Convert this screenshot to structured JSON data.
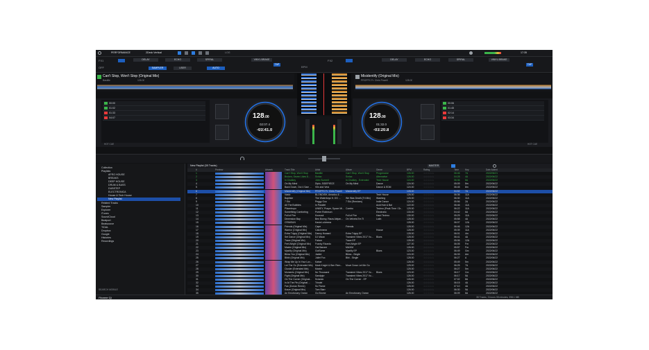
{
  "header": {
    "mode": "PERFORMANCE",
    "layout": "2Deck Vertical",
    "center_label": "LOG",
    "time": "17:35",
    "brand": "Pioneer Dj"
  },
  "fx": {
    "fx1_label": "FX1",
    "fx2_label": "FX2",
    "fx1_slots": [
      "DELAY",
      "ECHO",
      "SPIRAL"
    ],
    "fx2_slots": [
      "DELAY",
      "ECHO",
      "SPIRAL"
    ],
    "fx1_extra": "VINYL BRAKE",
    "fx2_extra": "VINYL BRAKE",
    "off_label": "OFF",
    "sampler_label": "SAMPLER",
    "user_label": "USER",
    "tap_label": "TAP",
    "auto_label": "AUTO",
    "bpm_label": "BPM"
  },
  "deck1": {
    "title": "Can't Stop, Won't Stop (Original Mix)",
    "artist": "Bastille",
    "bpm_small": "126.00",
    "bpm_int": "128",
    "bpm_dec": ".00",
    "elapsed": "02:07.4",
    "remain": "-03:41.0",
    "hotcue_label": "HOT CUE",
    "hotcues": [
      {
        "time": "00:00",
        "color": "#3bb54a"
      },
      {
        "time": "01:02",
        "color": "#3bb54a"
      },
      {
        "time": "01:33",
        "color": "#e83a3a"
      },
      {
        "time": "04:07",
        "color": "#e83a3a"
      }
    ]
  },
  "deck2": {
    "title": "Misidentify (Original Mix)",
    "artist": "PROPFX Fr. Chris Powell",
    "bpm_small": "128.00",
    "bpm_int": "128",
    "bpm_dec": ".00",
    "elapsed": "01:32.0",
    "remain": "-03:20.8",
    "hotcue_label": "HOT CUE",
    "hotcues": [
      {
        "time": "00:06",
        "color": "#3bb54a"
      },
      {
        "time": "01:45",
        "color": "#3bb54a"
      },
      {
        "time": "02:14",
        "color": "#e83a3a"
      },
      {
        "time": "03:34",
        "color": "#e83a3a"
      }
    ]
  },
  "browser": {
    "sidebar": [
      "Collection",
      "Playlists",
      "AFRO HOUSE",
      "BREAKS",
      "DEEP HOUSE",
      "DRUM & BASS",
      "DUBSTEP",
      "ELECTRONICA",
      "House & Tech House",
      "New Playlist",
      "Related Tracks",
      "Sampler",
      "Explorer",
      "iTunes",
      "SoundCloud",
      "Beatport",
      "Beatsource",
      "TIDAL",
      "Dropbox",
      "Google",
      "Histories",
      "Recordings"
    ],
    "search_mobile_label": "SEARCH MOBILE",
    "playlist_header": "New Playlist (35 Tracks)",
    "master_label": "MASTER",
    "status_text": "35 Tracks, 3 hours 05 minutes, 398.1 MB",
    "columns": [
      "#",
      "Preview",
      "Artwork",
      "Track Title",
      "Artist",
      "Album",
      "Genre",
      "BPM",
      "Rating",
      "Time",
      "Key",
      "Date Added"
    ],
    "tracks": [
      [
        "1",
        "Can't Stop, Won't Stop",
        "Bastille",
        "Can't Stop, Won't Stop",
        "Progressive",
        "126.00",
        "06:46",
        "7A",
        "2022/06/21"
      ],
      [
        "2",
        "Broken, Seven Likes 8...",
        "Svrlax",
        "Svrlax",
        "Alternative",
        "126.00",
        "04:28",
        "4A",
        "2022/06/22"
      ],
      [
        "3",
        "In Chalkey",
        "John Summit",
        "In Chalkey - Extended",
        "Tech House",
        "124.00",
        "06:36",
        "8A",
        "2022/06/22"
      ],
      [
        "4",
        "On My Mind",
        "Diplo, SIDEPIECE",
        "On My Mind",
        "Dance",
        "124.00",
        "05:09",
        "8m",
        "2022/06/22"
      ],
      [
        "5",
        "Back Down, Out 4 Sam ...",
        "Vlin and Vera",
        "",
        "Dance & EDM",
        "124.00",
        "06:45",
        "8m",
        "2022/06/22"
      ],
      [
        "6",
        "Misidentify (Original Mix)",
        "PROPFX Fr. Chris Powell",
        "Misidentify EP",
        "",
        "128.00",
        "04:52",
        "7A",
        "2022/06/22"
      ],
      [
        "7",
        "Vasto",
        "BLONDISH, Amadou & ...",
        "",
        "Tech House",
        "126.00",
        "06:36",
        "11A",
        "2022/06/22"
      ],
      [
        "8",
        "Baptiste",
        "The Waterboys ft. OG ...",
        "We Was Death (Tri Mix)",
        "Washing",
        "126.00",
        "06:30",
        "11A",
        "2022/06/22"
      ],
      [
        "9",
        "7 Ekt",
        "Peggy Gou",
        "7 Ekt (Remixes)",
        "Indie Dance",
        "124.00",
        "05:56",
        "2A",
        "2022/06/22"
      ],
      [
        "10",
        "All The Bubbles",
        "In Parallel",
        "",
        "Acid Hub & Bal",
        "122.00",
        "06:46",
        "11A",
        "2022/06/22"
      ],
      [
        "11",
        "Pilsentropo",
        "UNKEY, Prayer, Space Mi...",
        "Combo",
        "Techno (Peak Time / Dr...",
        "125.00",
        "06:22",
        "11A",
        "2022/06/22"
      ],
      [
        "12",
        "Something Comforting",
        "Porter Robinson",
        "",
        "Electronic",
        "133.00",
        "04:42",
        "6A",
        "2022/06/22"
      ],
      [
        "13",
        "Full of Fire",
        "Koosoul",
        "Full of Fire",
        "Hard Techno",
        "130.00",
        "05:29",
        "11A",
        "2022/06/22"
      ],
      [
        "14",
        "Dimension Bay",
        "Ben Bonny, Rauw Alejan...",
        "On Velvets Em Ti",
        "Latin",
        "128.00",
        "05:58",
        "4A",
        "2022/06/22"
      ],
      [
        "15",
        "CRIMSUN",
        "Kasia Lukimma",
        "",
        "",
        "128.00",
        "06:07",
        "12A",
        "2022/06/22"
      ],
      [
        "16",
        "Friends (Original Mix)",
        "Cape",
        "Friends",
        "",
        "128.00",
        "06:46",
        "12A",
        "2022/06/22"
      ],
      [
        "17",
        "Warrior (Original Mix)",
        "Catchmeez",
        "",
        "House",
        "128.00",
        "05:39",
        "11A",
        "2022/06/22"
      ],
      [
        "18",
        "Extra Trippy (Original Mix)",
        "Danny Howard",
        "Extra Trippy EP",
        "",
        "128.00",
        "06:01",
        "4m",
        "2022/06/22"
      ],
      [
        "19",
        "Set Dance (Original Mix)",
        "DJ Mizan",
        "Transient Vibes 2017 Vo...",
        "Blues",
        "128.00",
        "06:41",
        "4A",
        "2022/06/22"
      ],
      [
        "20",
        "Trace (Original Mix)",
        "Falcon",
        "Trace EP",
        "",
        "128.00",
        "05:06",
        "12A",
        "2022/06/22"
      ],
      [
        "21",
        "Feel Alright (Original Mix)",
        "Franky Rizardo",
        "Feel Alright EP",
        "",
        "127.00",
        "06:05",
        "Fm",
        "2022/06/22"
      ],
      [
        "22",
        "Maxim (Original Mix)",
        "Gal Barone",
        "MAXIM",
        "",
        "126.00",
        "05:57",
        "Fm",
        "2022/06/22"
      ],
      [
        "23",
        "Mystify (Original Mix)",
        "GotSome",
        "Mystify EP",
        "Blues",
        "123.00",
        "06:49",
        "Gm",
        "2022/06/22"
      ],
      [
        "24",
        "Bless You (Original Mix)",
        "Jaded",
        "Bless - Single",
        "",
        "124.00",
        "06:33",
        "Am",
        "2022/06/22"
      ],
      [
        "25",
        "Bibbi (Original Mix)",
        "Juliet Fox",
        "Bibi - Single",
        "",
        "128.00",
        "06:27",
        "A",
        "2022/06/22"
      ],
      [
        "26",
        "Wrap Me Up In Your Lov...",
        "Kaiser",
        "",
        "",
        "128.00",
        "05:49",
        "5m",
        "2022/06/22"
      ],
      [
        "27",
        "Let The Go (Extended Mix)",
        "Mark Knight & Ben Rem...",
        "Move Down Let Me Go",
        "",
        "125.00",
        "06:25",
        "7A",
        "2022/06/22"
      ],
      [
        "28",
        "Cluster (Extended Mix)",
        "Maxim",
        "",
        "",
        "125.00",
        "06:27",
        "5m",
        "2022/06/22"
      ],
      [
        "29",
        "Moments (Original Mix)",
        "No Thousand",
        "Transient Vibes 2017 Vo...",
        "Blues",
        "123.00",
        "06:17",
        "Cm",
        "2022/06/22"
      ],
      [
        "30",
        "Fight (Original Mix)",
        "Sandpipr",
        "Transient Vibes 2017 Vo...",
        "",
        "126.00",
        "06:17",
        "5A",
        "2022/06/22"
      ],
      [
        "31",
        "On The Corner (Original...",
        "Sciando",
        "On The Corner - EP",
        "",
        "126.00",
        "07:02",
        "8A",
        "2022/06/22"
      ],
      [
        "32",
        "In At The Pin (Original ...",
        "Trindel",
        "",
        "",
        "126.00",
        "06:15",
        "4A",
        "2022/06/22"
      ],
      [
        "33",
        "Fan (Dorian Remix)",
        "So Flame",
        "",
        "",
        "126.00",
        "07:10",
        "4A",
        "2022/06/22"
      ],
      [
        "34",
        "Kraze (Original Mix)",
        "Tom Starr",
        "",
        "",
        "126.00",
        "06:30",
        "9A",
        "2022/06/22"
      ],
      [
        "35",
        "An Emotionary Ocean",
        "Go Brome",
        "An Emotionary Ocean",
        "",
        "126.00",
        "06:09",
        "6A",
        "2022/06/22"
      ]
    ]
  }
}
